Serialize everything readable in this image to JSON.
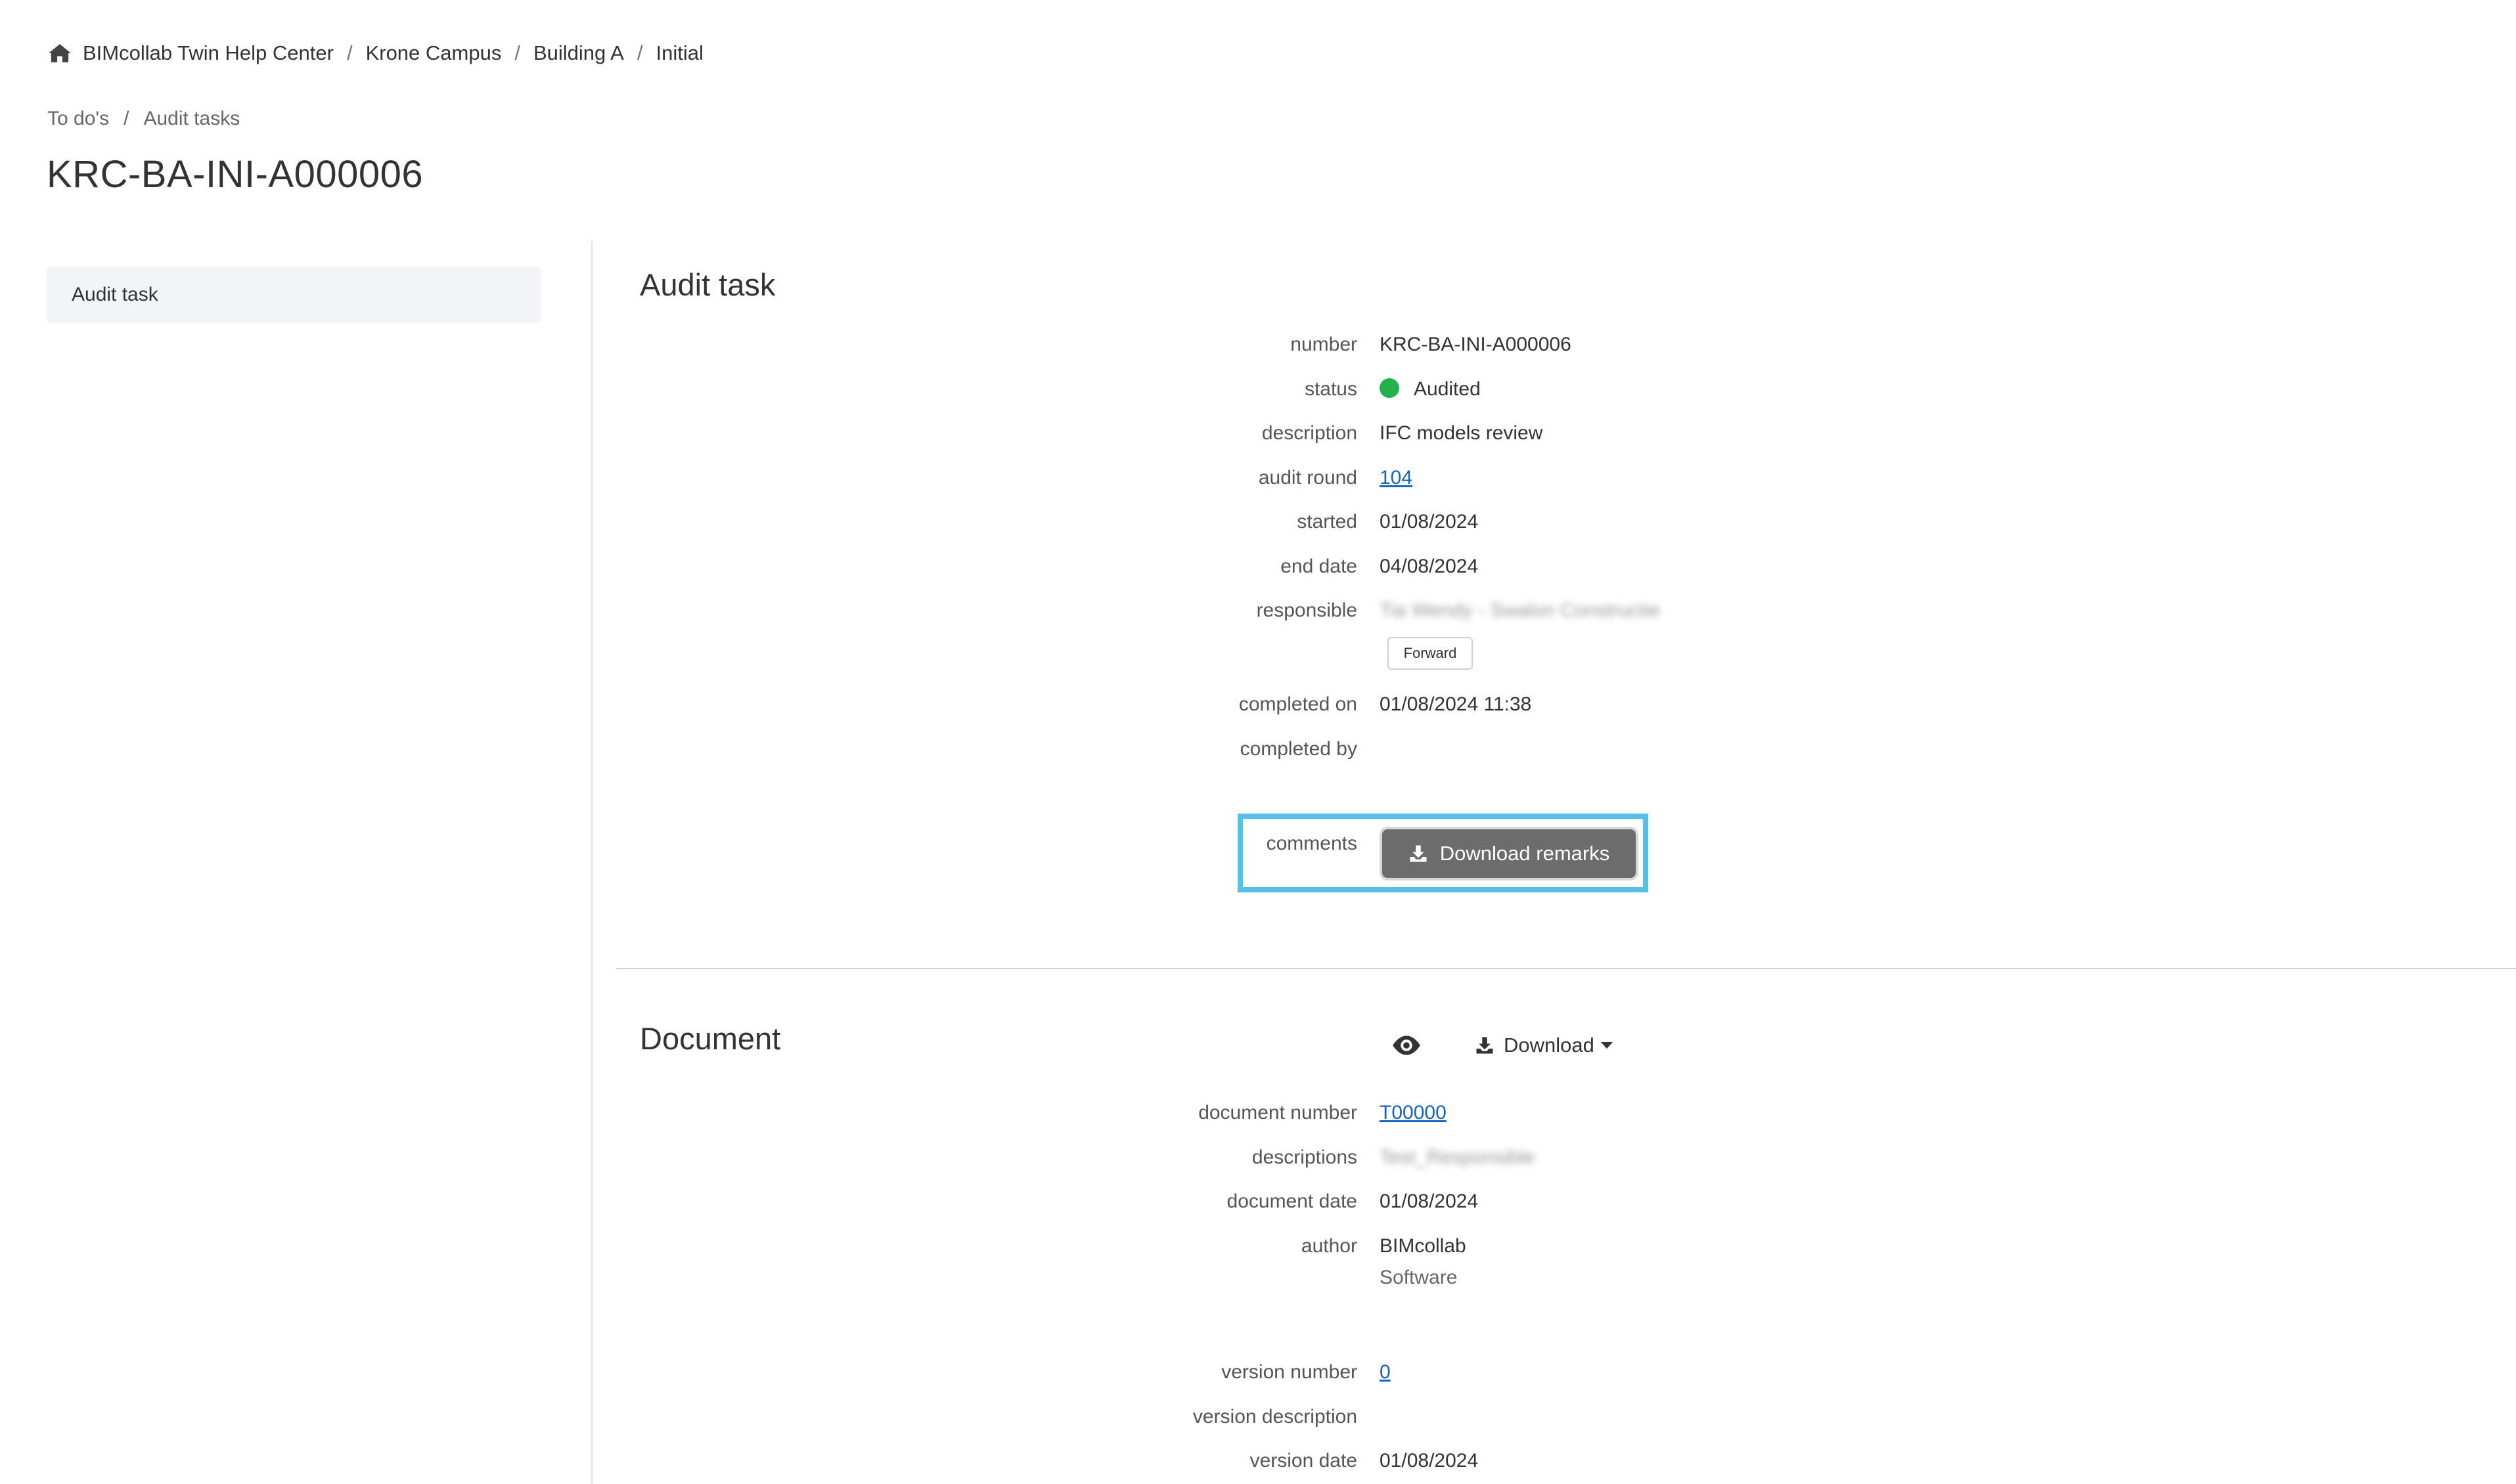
{
  "breadcrumb": {
    "items": [
      "BIMcollab Twin Help Center",
      "Krone Campus",
      "Building A",
      "Initial"
    ],
    "separator": "/"
  },
  "sub_breadcrumb": {
    "items": [
      "To do's",
      "Audit tasks"
    ],
    "separator": "/"
  },
  "page_title": "KRC-BA-INI-A000006",
  "sidebar": {
    "items": [
      {
        "label": "Audit task"
      }
    ]
  },
  "audit_task": {
    "title": "Audit task",
    "number": {
      "label": "number",
      "value": "KRC-BA-INI-A000006"
    },
    "status": {
      "label": "status",
      "value": "Audited",
      "color": "#22b14c"
    },
    "description": {
      "label": "description",
      "value": "IFC models review"
    },
    "audit_round": {
      "label": "audit round",
      "value": "104"
    },
    "started": {
      "label": "started",
      "value": "01/08/2024"
    },
    "end_date": {
      "label": "end date",
      "value": "04/08/2024"
    },
    "responsible": {
      "label": "responsible",
      "value": "Tia Wendy - Swalon Constructie"
    },
    "forward_label": "Forward",
    "completed_on": {
      "label": "completed on",
      "value": "01/08/2024 11:38"
    },
    "completed_by": {
      "label": "completed by",
      "value": ""
    },
    "comments": {
      "label": "comments"
    },
    "download_remarks_label": "Download remarks",
    "highlight_color": "#55bfe7"
  },
  "document": {
    "title": "Document",
    "download_label": "Download",
    "document_number": {
      "label": "document number",
      "value": "T00000"
    },
    "descriptions": {
      "label": "descriptions",
      "value": "Test_Responsible"
    },
    "document_date": {
      "label": "document date",
      "value": "01/08/2024"
    },
    "author": {
      "label": "author",
      "value": "BIMcollab",
      "value2": "Software"
    },
    "version_number": {
      "label": "version number",
      "value": "0"
    },
    "version_description": {
      "label": "version description",
      "value": ""
    },
    "version_date": {
      "label": "version date",
      "value": "01/08/2024"
    }
  },
  "icons": [
    "home-icon",
    "download-icon",
    "eye-icon",
    "caret-down-icon"
  ],
  "colors": {
    "accent_link": "#1565c0",
    "button_dark": "#6c6c6c",
    "sidebar_bg": "#f3f4f6"
  }
}
